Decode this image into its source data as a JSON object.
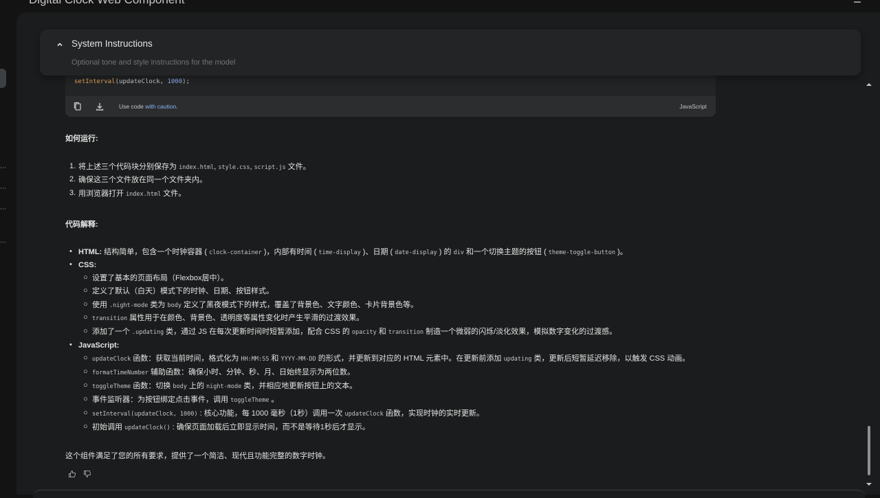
{
  "top": {
    "title": "Digital Clock Web Component"
  },
  "system_instructions": {
    "title": "System Instructions",
    "placeholder": "Optional tone and style instructions for the model"
  },
  "code_block": {
    "line_fn": "setInterval",
    "line_open": "(updateClock, ",
    "line_num": "1000",
    "line_close": ");",
    "caution_prefix": "Use code ",
    "caution_link": "with caution",
    "caution_suffix": ".",
    "language": "JavaScript"
  },
  "how_to_run": {
    "heading": "如何运行:",
    "items": [
      {
        "num": "1.",
        "parts": [
          {
            "t": "将上述三个代码块分别保存为 "
          },
          {
            "m": "index.html"
          },
          {
            "t": ", "
          },
          {
            "m": "style.css"
          },
          {
            "t": ", "
          },
          {
            "m": "script.js"
          },
          {
            "t": " 文件。"
          }
        ]
      },
      {
        "num": "2.",
        "parts": [
          {
            "t": "确保这三个文件放在同一个文件夹内。"
          }
        ]
      },
      {
        "num": "3.",
        "parts": [
          {
            "t": "用浏览器打开 "
          },
          {
            "m": "index.html"
          },
          {
            "t": " 文件。"
          }
        ]
      }
    ]
  },
  "code_explain": {
    "heading": "代码解释:",
    "html_item": {
      "label": "HTML:",
      "parts": [
        {
          "t": " 结构简单，包含一个时钟容器 ( "
        },
        {
          "m": "clock-container"
        },
        {
          "t": " )，内部有时间 ( "
        },
        {
          "m": "time-display"
        },
        {
          "t": " )、日期 ( "
        },
        {
          "m": "date-display"
        },
        {
          "t": " ) 的 "
        },
        {
          "m": "div"
        },
        {
          "t": " 和一个切换主题的按钮 ( "
        },
        {
          "m": "theme-toggle-button"
        },
        {
          "t": " )。"
        }
      ]
    },
    "css_item": {
      "label": "CSS:",
      "sub": [
        [
          {
            "t": "设置了基本的页面布局（Flexbox居中）。"
          }
        ],
        [
          {
            "t": "定义了默认（白天）模式下的时钟、日期、按钮样式。"
          }
        ],
        [
          {
            "t": "使用 "
          },
          {
            "m": ".night-mode"
          },
          {
            "t": " 类为 "
          },
          {
            "m": "body"
          },
          {
            "t": " 定义了黑夜模式下的样式，覆盖了背景色、文字颜色、卡片背景色等。"
          }
        ],
        [
          {
            "m": "transition"
          },
          {
            "t": " 属性用于在颜色、背景色、透明度等属性变化时产生平滑的过渡效果。"
          }
        ],
        [
          {
            "t": "添加了一个 "
          },
          {
            "m": ".updating"
          },
          {
            "t": " 类，通过 JS 在每次更新时间时短暂添加，配合 CSS 的 "
          },
          {
            "m": "opacity"
          },
          {
            "t": " 和 "
          },
          {
            "m": "transition"
          },
          {
            "t": " 制造一个微弱的闪烁/淡化效果，模拟数字变化的过渡感。"
          }
        ]
      ]
    },
    "js_item": {
      "label": "JavaScript:",
      "sub": [
        [
          {
            "m": "updateClock"
          },
          {
            "t": " 函数：获取当前时间，格式化为 "
          },
          {
            "m": "HH:MM:SS"
          },
          {
            "t": " 和 "
          },
          {
            "m": "YYYY-MM-DD"
          },
          {
            "t": " 的形式，并更新到对应的 HTML 元素中。在更新前添加 "
          },
          {
            "m": "updating"
          },
          {
            "t": " 类，更新后短暂延迟移除，以触发 CSS 动画。"
          }
        ],
        [
          {
            "m": "formatTimeNumber"
          },
          {
            "t": " 辅助函数：确保小时、分钟、秒、月、日始终显示为两位数。"
          }
        ],
        [
          {
            "m": "toggleTheme"
          },
          {
            "t": " 函数：切换 "
          },
          {
            "m": "body"
          },
          {
            "t": " 上的 "
          },
          {
            "m": "night-mode"
          },
          {
            "t": " 类，并相应地更新按钮上的文本。"
          }
        ],
        [
          {
            "t": "事件监听器：为按钮绑定点击事件，调用 "
          },
          {
            "m": "toggleTheme"
          },
          {
            "t": " 。"
          }
        ],
        [
          {
            "m": "setInterval(updateClock, 1000)"
          },
          {
            "t": " : 核心功能，每 1000 毫秒（1秒）调用一次 "
          },
          {
            "m": "updateClock"
          },
          {
            "t": " 函数，实现时钟的实时更新。"
          }
        ],
        [
          {
            "t": "初始调用 "
          },
          {
            "m": "updateClock()"
          },
          {
            "t": " : 确保页面加载后立即显示时间，而不是等待1秒后才显示。"
          }
        ]
      ]
    }
  },
  "summary": "这个组件满足了您的所有要求，提供了一个简洁、现代且功能完整的数字时钟。",
  "icons": {
    "chevron": "chevron-up-icon",
    "copy": "copy-icon",
    "download": "download-icon",
    "thumbs_up": "thumbs-up-icon",
    "thumbs_down": "thumbs-down-icon"
  }
}
